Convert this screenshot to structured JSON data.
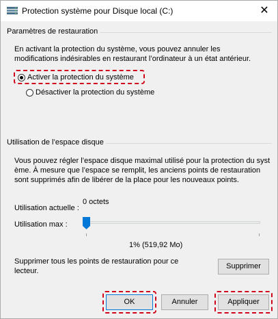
{
  "window": {
    "title": "Protection système pour Disque local (C:)",
    "close_glyph": "✕"
  },
  "restore_settings": {
    "heading": "Paramètres de restauration",
    "description_line1": "En activant la protection du système, vous pouvez annuler les",
    "description_line2": "modifications indésirables en restaurant l’ordinateur à un état antérieur.",
    "option_enable": "Activer la protection du système",
    "option_disable": "Désactiver la protection du système",
    "selected": "enable"
  },
  "disk_usage": {
    "heading": "Utilisation de l’espace disque",
    "description_line1": "Vous pouvez régler l’espace disque maximal utilisé pour la protection du syst",
    "description_line2": "ème. À mesure que l’espace se remplit, les anciens points de restauration",
    "description_line3": "sont supprimés afin de libérer de la place pour les nouveaux points.",
    "current_label": "Utilisation actuelle :",
    "current_value": "0 octets",
    "max_label": "Utilisation max :",
    "max_value": "1% (519,92 Mo)",
    "max_percent": 1,
    "delete_line1": "Supprimer tous les points de restauration pour ce",
    "delete_line2": "lecteur.",
    "delete_button": "Supprimer"
  },
  "footer": {
    "ok": "OK",
    "cancel": "Annuler",
    "apply": "Appliquer"
  },
  "colors": {
    "highlight": "#d0021b",
    "accent": "#0078d7"
  },
  "icons": {
    "title": "system-protection-icon",
    "close": "close-icon"
  }
}
